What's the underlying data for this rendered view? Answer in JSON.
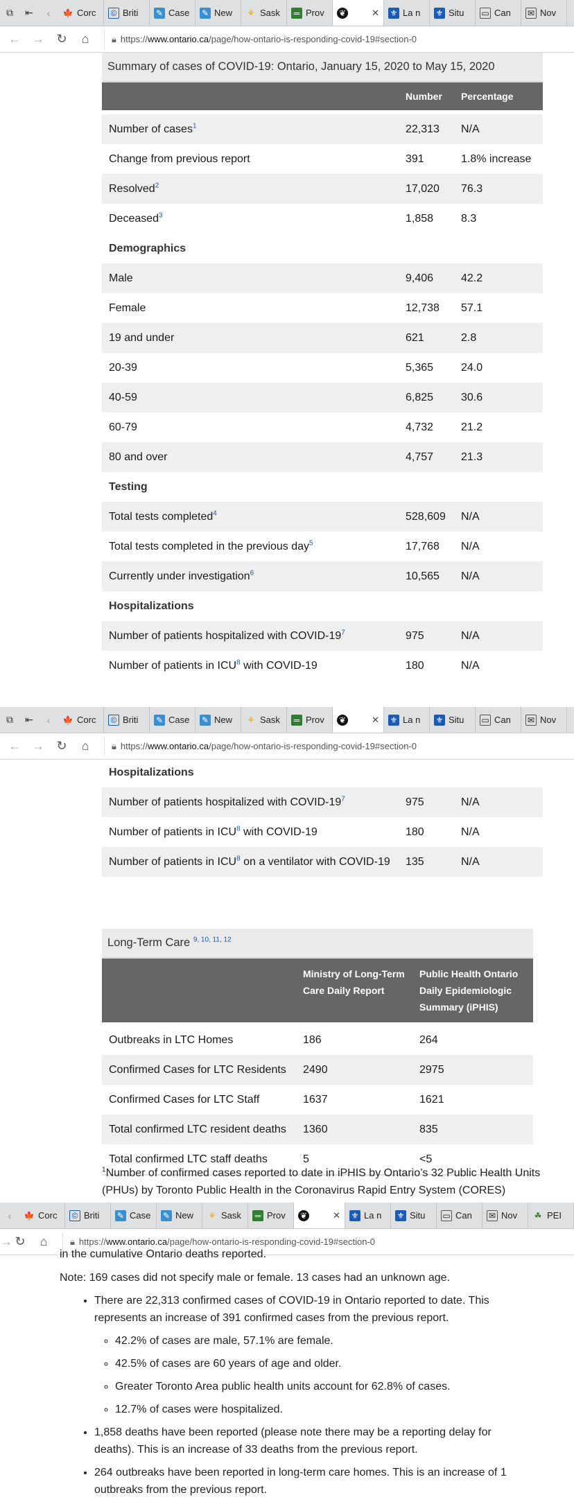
{
  "browser": {
    "tabs": [
      "Corc",
      "Briti",
      "Case",
      "New",
      "Sask",
      "Prov",
      "",
      "La n",
      "Situ",
      "Can",
      "Nov"
    ],
    "tabs3": [
      "Corc",
      "Briti",
      "Case",
      "New",
      "Sask",
      "Prov",
      "",
      "La n",
      "Situ",
      "Can",
      "Nov",
      "PEI"
    ],
    "url_prefix": "https://",
    "url_domain": "www.ontario.ca",
    "url_path": "/page/how-ontario-is-responding-covid-19#section-0"
  },
  "summary": {
    "caption": "Summary of cases of COVID-19: Ontario, January 15, 2020 to May 15, 2020",
    "col_number": "Number",
    "col_percentage": "Percentage",
    "rows": [
      {
        "label": "Number of cases",
        "sup": "1",
        "number": "22,313",
        "pct": "N/A"
      },
      {
        "label": "Change from previous report",
        "sup": "",
        "number": "391",
        "pct": "1.8% increase"
      },
      {
        "label": "Resolved",
        "sup": "2",
        "number": "17,020",
        "pct": "76.3"
      },
      {
        "label": "Deceased",
        "sup": "3",
        "number": "1,858",
        "pct": "8.3"
      },
      {
        "label": "Demographics",
        "section": true
      },
      {
        "label": "Male",
        "sup": "",
        "number": "9,406",
        "pct": "42.2"
      },
      {
        "label": "Female",
        "sup": "",
        "number": "12,738",
        "pct": "57.1"
      },
      {
        "label": "19 and under",
        "sup": "",
        "number": "621",
        "pct": "2.8"
      },
      {
        "label": "20-39",
        "sup": "",
        "number": "5,365",
        "pct": "24.0"
      },
      {
        "label": "40-59",
        "sup": "",
        "number": "6,825",
        "pct": "30.6"
      },
      {
        "label": "60-79",
        "sup": "",
        "number": "4,732",
        "pct": "21.2"
      },
      {
        "label": "80 and over",
        "sup": "",
        "number": "4,757",
        "pct": "21.3"
      },
      {
        "label": "Testing",
        "section": true
      },
      {
        "label": "Total tests completed",
        "sup": "4",
        "number": "528,609",
        "pct": "N/A"
      },
      {
        "label": "Total tests completed in the previous day",
        "sup": "5",
        "number": "17,768",
        "pct": "N/A"
      },
      {
        "label": "Currently under investigation",
        "sup": "6",
        "number": "10,565",
        "pct": "N/A"
      },
      {
        "label": "Hospitalizations",
        "section": true
      },
      {
        "label": "Number of patients hospitalized with COVID-19",
        "sup": "7",
        "number": "975",
        "pct": "N/A"
      },
      {
        "label": "Number of patients in ICU",
        "sup": "8",
        "label_after": " with COVID-19",
        "number": "180",
        "pct": "N/A"
      }
    ],
    "section_hosp": "Hospitalizations",
    "hosp_rows": [
      {
        "label": "Number of patients hospitalized with COVID-19",
        "sup": "7",
        "label_after": "",
        "number": "975",
        "pct": "N/A"
      },
      {
        "label": "Number of patients in ICU",
        "sup": "8",
        "label_after": " with COVID-19",
        "number": "180",
        "pct": "N/A"
      },
      {
        "label": "Number of patients in ICU",
        "sup": "8",
        "label_after": " on a ventilator with COVID-19",
        "number": "135",
        "pct": "N/A"
      }
    ]
  },
  "ltc": {
    "caption": "Long-Term Care",
    "caption_sups": "9, 10, 11, 12",
    "col_ministry": "Ministry of Long-Term Care Daily Report",
    "col_pho": "Public Health Ontario Daily Epidemiologic Summary (iPHIS)",
    "rows": [
      {
        "label": "Outbreaks in LTC Homes",
        "ministry": "186",
        "pho": "264"
      },
      {
        "label": "Confirmed Cases for LTC Residents",
        "ministry": "2490",
        "pho": "2975"
      },
      {
        "label": "Confirmed Cases for LTC Staff",
        "ministry": "1637",
        "pho": "1621"
      },
      {
        "label": "Total confirmed LTC resident deaths",
        "ministry": "1360",
        "pho": "835"
      },
      {
        "label": "Total confirmed LTC staff deaths",
        "ministry": "5",
        "pho": "<5"
      }
    ]
  },
  "footnote1": {
    "sup": "1",
    "text": "Number of confirmed cases reported to date in iPHIS by Ontario’s 32 Public Health Units (PHUs) by Toronto Public Health in the Coronavirus Rapid Entry System (CORES)"
  },
  "notes": {
    "cut_line": "in the cumulative Ontario deaths reported.",
    "note": "Note: 169 cases did not specify male or female. 13 cases had an unknown age.",
    "bullets": [
      "There are 22,313 confirmed cases of COVID-19 in Ontario reported to date. This represents an increase of 391 confirmed cases from the previous report.",
      "1,858 deaths have been reported (please note there may be a reporting delay for deaths). This is an increase of 33 deaths from the previous report.",
      "264 outbreaks have been reported in long-term care homes. This is an increase of 1 outbreaks from the previous report."
    ],
    "sub_bullets": [
      "42.2% of cases are male, 57.1% are female.",
      "42.5% of cases are 60 years of age and older.",
      "Greater Toronto Area public health units account for 62.8% of cases.",
      "12.7% of cases were hospitalized."
    ]
  }
}
